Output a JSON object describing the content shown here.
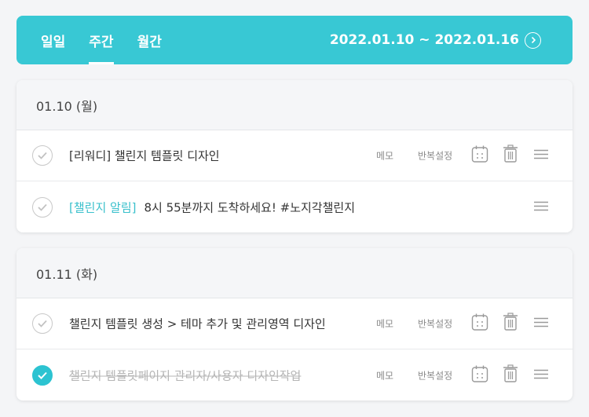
{
  "header": {
    "tabs": [
      {
        "label": "일일",
        "active": false
      },
      {
        "label": "주간",
        "active": true
      },
      {
        "label": "월간",
        "active": false
      }
    ],
    "range": "2022.01.10 ~ 2022.01.16",
    "next_icon": "chevron-right-circle-icon"
  },
  "days": [
    {
      "date": "01.10 (월)",
      "tasks": [
        {
          "text": "[리워디] 챌린지 템플릿 디자인",
          "done": false,
          "memo": "메모",
          "repeat": "반복설정"
        },
        {
          "tag": "[챌린지 알림]",
          "text": "8시 55분까지 도착하세요! #노지각챌린지",
          "done": false
        }
      ]
    },
    {
      "date": "01.11 (화)",
      "tasks": [
        {
          "text": "챌린지 템플릿 생성 > 테마 추가 및 관리영역 디자인",
          "done": false,
          "memo": "메모",
          "repeat": "반복설정"
        },
        {
          "text": "챌린지 템플릿페이지 관리자/사용자 디자인작업",
          "done": true,
          "memo": "메모",
          "repeat": "반복설정"
        }
      ]
    }
  ],
  "colors": {
    "accent": "#38c8d4",
    "check_done": "#2cc3d1",
    "tag": "#3ac0cc"
  }
}
